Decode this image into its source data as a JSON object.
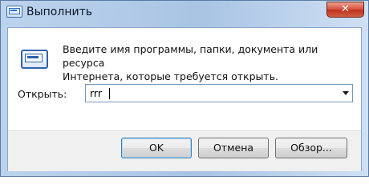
{
  "window": {
    "title": "Выполнить",
    "close_label": "✕"
  },
  "dialog": {
    "description_line1": "Введите имя программы, папки, документа или ресурса",
    "description_line2": "Интернета, которые требуется открыть.",
    "open_label": "Открыть:",
    "input_value": "rrr"
  },
  "buttons": {
    "ok": "OK",
    "cancel": "Отмена",
    "browse": "Обзор..."
  },
  "icons": {
    "app": "run-icon",
    "dialog": "run-program-icon",
    "dropdown": "chevron-down-icon"
  },
  "colors": {
    "title_gradient_start": "#bcd3ec",
    "close_red": "#c0321d",
    "default_button_border": "#3c7fb1"
  }
}
